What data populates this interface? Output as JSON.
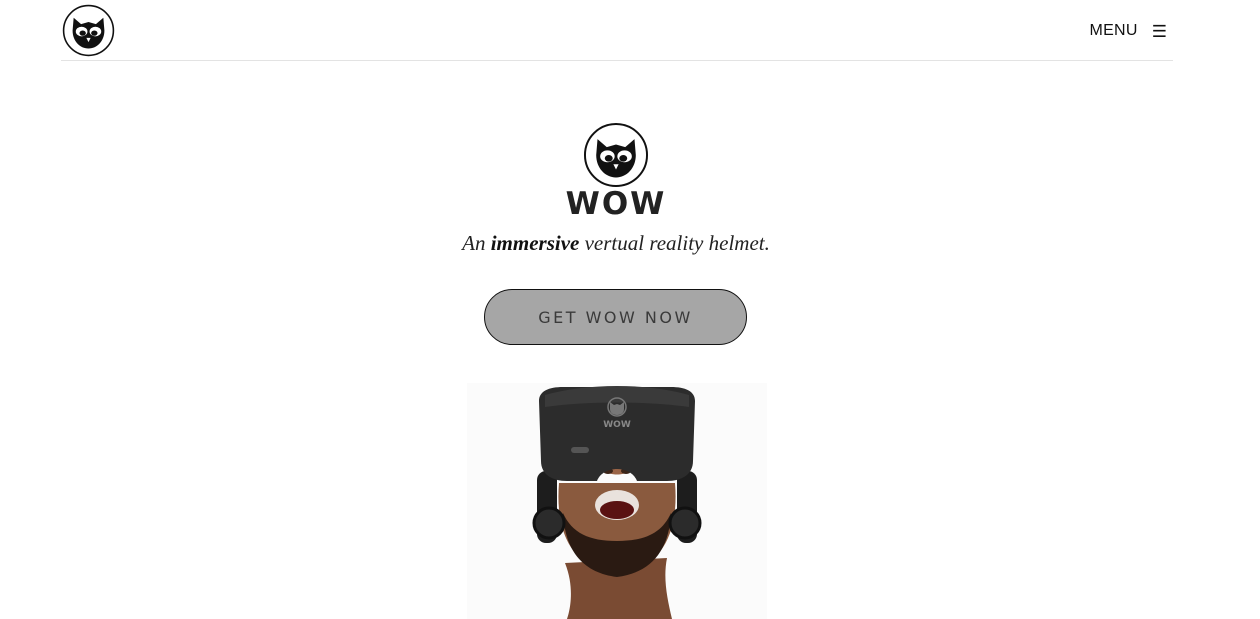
{
  "header": {
    "logo_icon": "owl-logo-icon",
    "menu_label": "MENU",
    "menu_icon": "☰"
  },
  "hero": {
    "logo_icon": "owl-logo-icon",
    "brand_name": "WOW",
    "tagline_prefix": "An ",
    "tagline_emphasis": "immersive",
    "tagline_suffix": " vertual reality helmet.",
    "cta_label": "GET WOW NOW",
    "headset_logo_text": "WOW",
    "image_subject": "man-wearing-vr-headset"
  },
  "colors": {
    "cta_background": "#a6a6a6",
    "text": "#111111",
    "divider": "#e3e3e3"
  }
}
